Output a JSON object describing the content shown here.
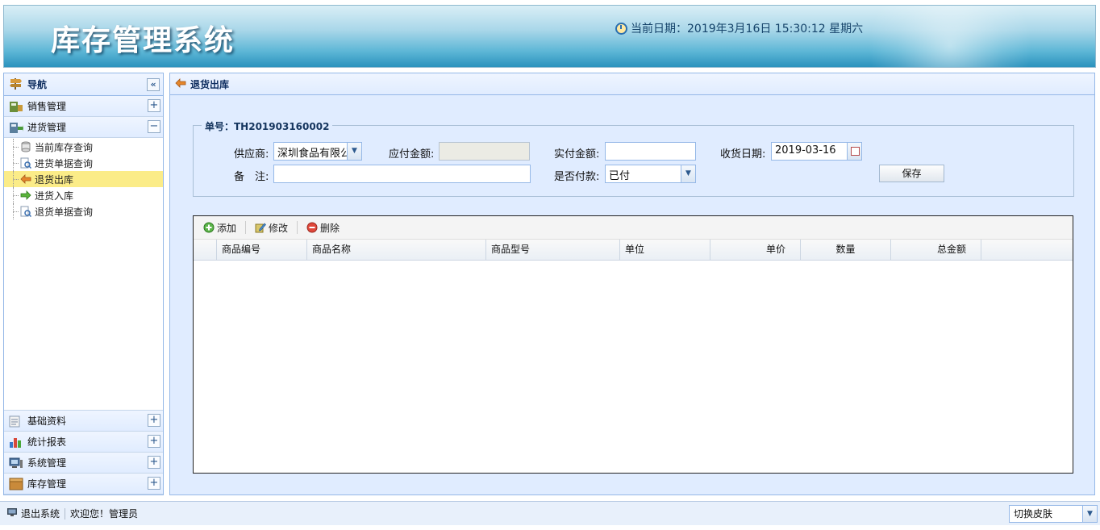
{
  "header": {
    "title": "库存管理系统",
    "clock_text": "当前日期：2019年3月16日 15:30:12 星期六"
  },
  "nav": {
    "title": "导航",
    "collapse_glyph": "«",
    "sections": [
      {
        "label": "销售管理",
        "toggle": "+"
      },
      {
        "label": "进货管理",
        "toggle": "−"
      },
      {
        "label": "基础资料",
        "toggle": "+"
      },
      {
        "label": "统计报表",
        "toggle": "+"
      },
      {
        "label": "系统管理",
        "toggle": "+"
      },
      {
        "label": "库存管理",
        "toggle": "+"
      }
    ],
    "purchase_items": [
      {
        "label": "当前库存查询",
        "icon": "database-icon"
      },
      {
        "label": "进货单据查询",
        "icon": "search-doc-icon"
      },
      {
        "label": "退货出库",
        "icon": "return-arrow-icon",
        "selected": true
      },
      {
        "label": "进货入库",
        "icon": "green-arrow-icon"
      },
      {
        "label": "退货单据查询",
        "icon": "search-doc-icon"
      }
    ]
  },
  "main": {
    "tab_title": "退货出库",
    "order_legend": "单号：TH201903160002",
    "form": {
      "supplier_label": "供应商:",
      "supplier_value": "深圳食品有限公司",
      "payable_label": "应付金额:",
      "payable_value": "",
      "paid_label": "实付金额:",
      "paid_value": "",
      "date_label": "收货日期:",
      "date_value": "2019-03-16",
      "remark_label": "备　注:",
      "remark_value": "",
      "is_paid_label": "是否付款:",
      "is_paid_value": "已付",
      "save_label": "保存"
    },
    "toolbar": {
      "add": "添加",
      "edit": "修改",
      "delete": "删除"
    },
    "columns": [
      "商品编号",
      "商品名称",
      "商品型号",
      "单位",
      "单价",
      "数量",
      "总金额"
    ],
    "rows": []
  },
  "status": {
    "logout": "退出系统",
    "welcome": "欢迎您！管理员",
    "skin": "切换皮肤"
  },
  "colors": {
    "panel_header": "#e0ecff",
    "selected_row": "#fbec88",
    "border": "#95b8e7"
  }
}
